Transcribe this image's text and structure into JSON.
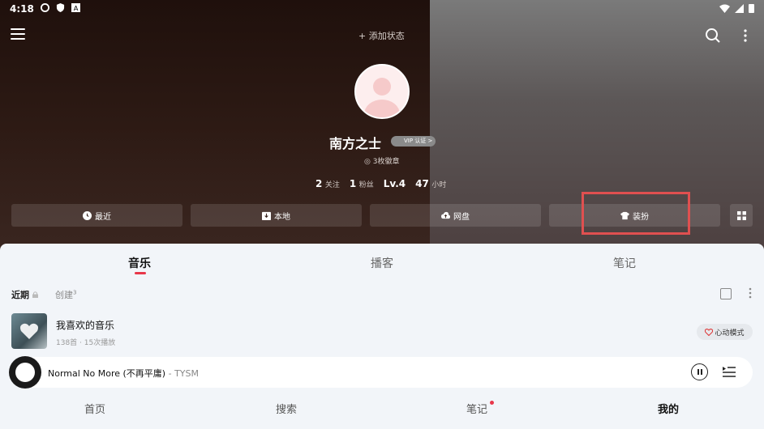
{
  "status_bar": {
    "time": "4:18"
  },
  "header": {
    "add_status": "+ 添加状态"
  },
  "profile": {
    "name": "南方之士",
    "vip_label": "VIP",
    "vip_extra": "认证 >",
    "medals": "◎ 3枚徽章",
    "stats": [
      {
        "value": "2",
        "label": "关注"
      },
      {
        "value": "1",
        "label": "粉丝"
      },
      {
        "value": "Lv.4",
        "label": ""
      },
      {
        "value": "47",
        "label": "小时"
      }
    ]
  },
  "actions": [
    {
      "label": "最近",
      "icon": "clock-icon"
    },
    {
      "label": "本地",
      "icon": "download-box-icon"
    },
    {
      "label": "网盘",
      "icon": "cloud-upload-icon"
    },
    {
      "label": "装扮",
      "icon": "shirt-icon"
    }
  ],
  "tabs": [
    {
      "label": "音乐",
      "active": true
    },
    {
      "label": "播客",
      "active": false
    },
    {
      "label": "笔记",
      "active": false
    }
  ],
  "subtabs": {
    "recent": "近期",
    "created": "创建",
    "created_count": "3"
  },
  "playlist": {
    "title": "我喜欢的音乐",
    "subtitle": "138首 · 15次播放",
    "heart_mode": "心动模式"
  },
  "player": {
    "song": "Normal No More (不再平庸)",
    "artist": " - TYSM"
  },
  "bottom_nav": [
    {
      "label": "首页",
      "active": false
    },
    {
      "label": "搜索",
      "active": false
    },
    {
      "label": "笔记",
      "active": false,
      "badge": true
    },
    {
      "label": "我的",
      "active": true
    }
  ],
  "colors": {
    "accent": "#e8374a",
    "highlight_box": "#e05050"
  }
}
